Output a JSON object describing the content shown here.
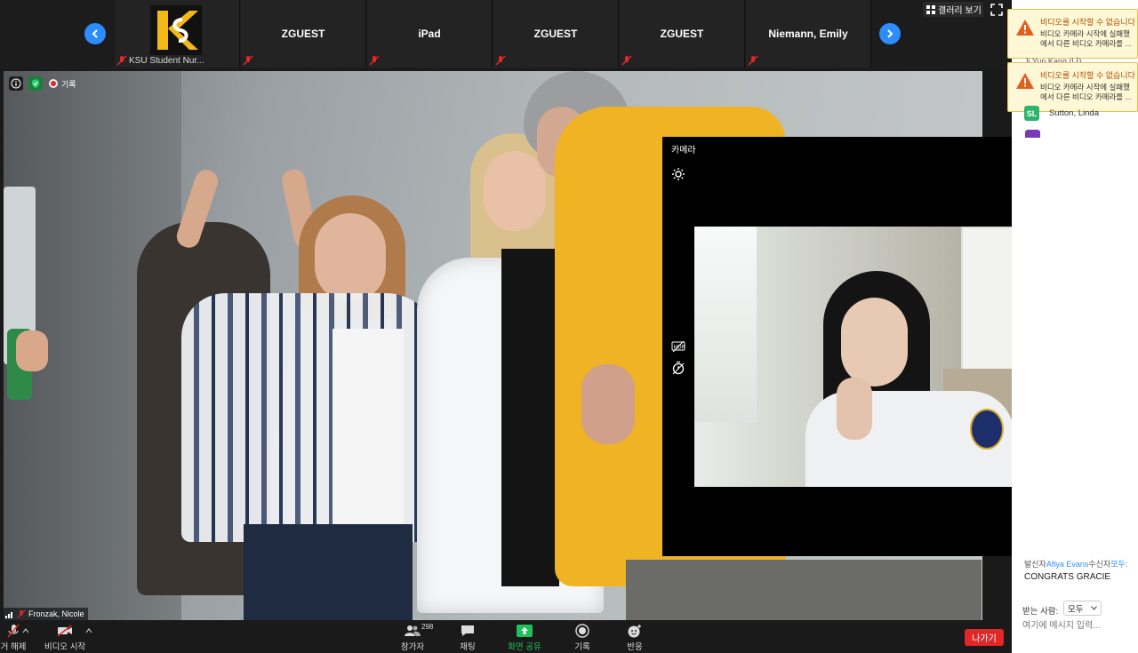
{
  "gallery": {
    "view_label": "갤러리 보기",
    "tiles": [
      {
        "name": "",
        "footer": "KSU Student Nur..."
      },
      {
        "name": "ZGUEST",
        "footer": ""
      },
      {
        "name": "iPad",
        "footer": ""
      },
      {
        "name": "ZGUEST",
        "footer": ""
      },
      {
        "name": "ZGUEST",
        "footer": ""
      },
      {
        "name": "Niemann, Emily",
        "footer": ""
      }
    ]
  },
  "main_video": {
    "recording_label": "기록",
    "speaker_name": "Fronzak, Nicole"
  },
  "camera_panel": {
    "title": "카메라"
  },
  "side_panel": {
    "notifications": [
      {
        "title": "비디오를 시작할 수 없습니다",
        "line1": "비디오 카메라 시작에 실패했",
        "line2": "에서 다른 비디오 카메라를 ..."
      },
      {
        "title": "비디오를 시작할 수 없습니다",
        "line1": "비디오 카메라 시작에 실패했",
        "line2": "에서 다른 비디오 카메라를 ..."
      }
    ],
    "partial_participant": "Ji Yun Kang (나)",
    "participant": {
      "initials": "SL",
      "name": "Sutton, Linda"
    },
    "chat": {
      "from_prefix": "발신자",
      "from_name": "Afiya Evans",
      "to_mid": "수신자",
      "to_name": "모두",
      "to_suffix": ":",
      "message": "CONGRATS GRACIE"
    },
    "recipient_label": "받는 사람:",
    "recipient_value": "모두",
    "input_placeholder": "여기에 메시지 입력..."
  },
  "toolbar": {
    "mute_label": "거 해제",
    "video_label": "비디오 시작",
    "participants_label": "참가자",
    "participants_count": "298",
    "chat_label": "채팅",
    "share_label": "화면 공유",
    "record_label": "기록",
    "reactions_label": "반응",
    "leave_label": "나가기"
  },
  "colors": {
    "accent_blue": "#2d8cff",
    "share_green": "#1ec25a",
    "leave_red": "#e02828",
    "mic_muted_red": "#e02828",
    "warning_orange": "#e25e1f"
  }
}
